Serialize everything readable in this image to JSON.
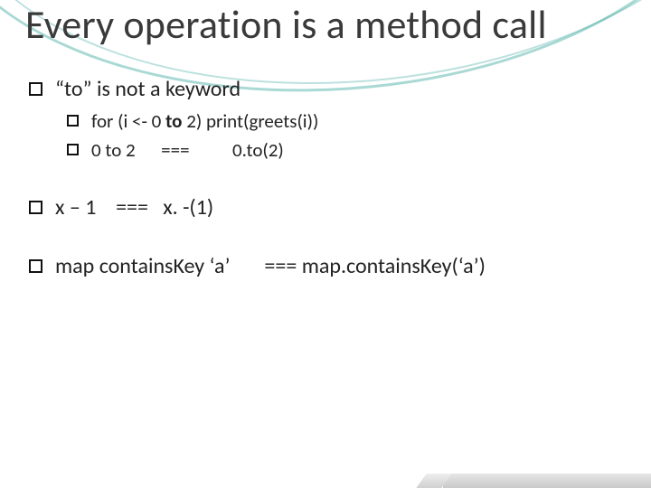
{
  "title": "Every operation is a method call",
  "bullets": {
    "b1": "“to” is not a keyword",
    "b1a_pre": "for (i <- 0 ",
    "b1a_bold": "to",
    "b1a_post": " 2) print(greets(i))",
    "b1b": "0 to 2      ===          0.to(2)",
    "b2": "x – 1    ===   x. -(1)",
    "b3": "map containsKey ‘a’       === map.containsKey(‘a’)"
  }
}
